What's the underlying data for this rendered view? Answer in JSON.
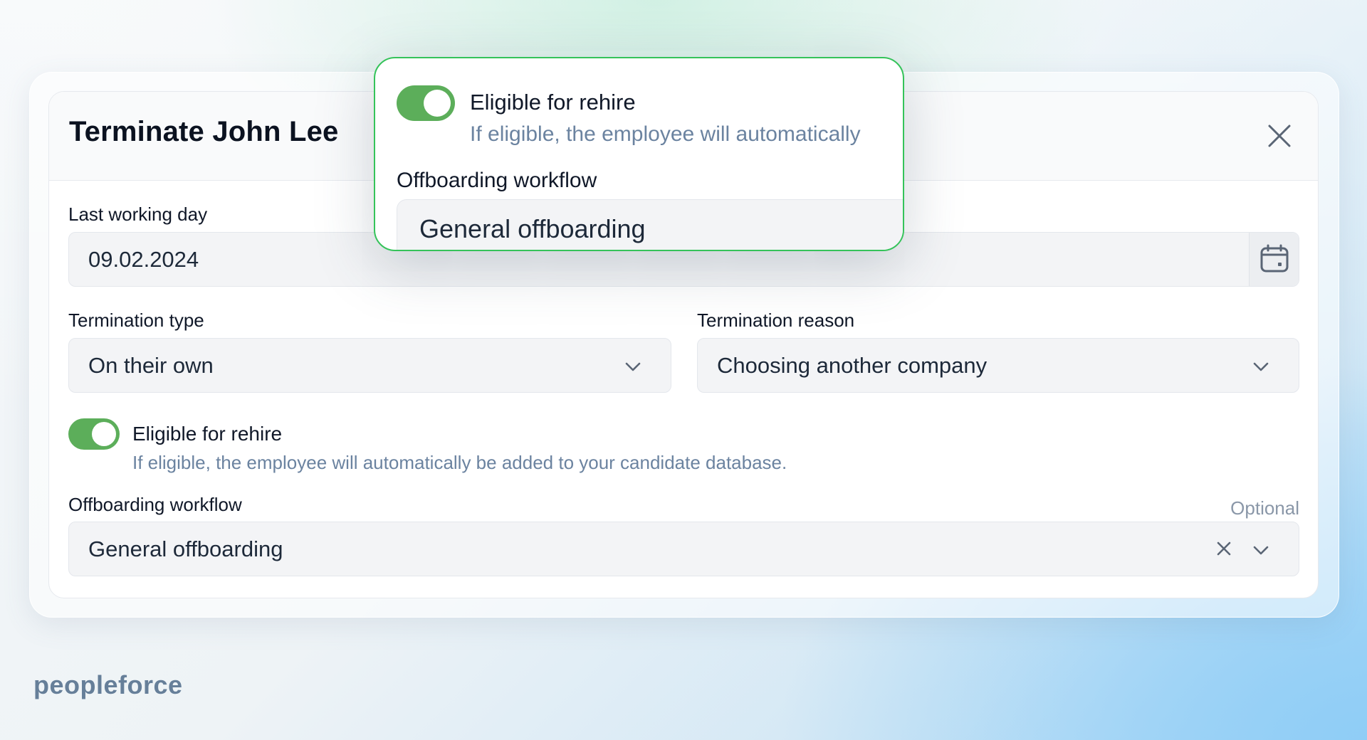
{
  "dialog": {
    "title": "Terminate John Lee",
    "close_icon": "close-icon"
  },
  "last_working_day": {
    "label": "Last working day",
    "value": "09.02.2024",
    "icon": "calendar-icon"
  },
  "termination_type": {
    "label": "Termination type",
    "value": "On their own",
    "icon": "chevron-down-icon"
  },
  "termination_reason": {
    "label": "Termination reason",
    "value": "Choosing another company",
    "icon": "chevron-down-icon"
  },
  "rehire": {
    "label": "Eligible for rehire",
    "description": "If eligible, the employee will automatically be added to your candidate database.",
    "enabled": true
  },
  "offboarding": {
    "label": "Offboarding workflow",
    "optional_label": "Optional",
    "value": "General offboarding",
    "clear_icon": "close-icon",
    "chevron_icon": "chevron-down-icon"
  },
  "callout": {
    "rehire_label": "Eligible for rehire",
    "rehire_description": "If eligible, the employee will automatically",
    "offboarding_label": "Offboarding workflow",
    "offboarding_value": "General offboarding"
  },
  "brand": {
    "logo_text": "peopleforce"
  },
  "colors": {
    "toggle_on": "#5cae5a",
    "callout_border": "#35c35a",
    "muted_text": "#6b83a0"
  }
}
